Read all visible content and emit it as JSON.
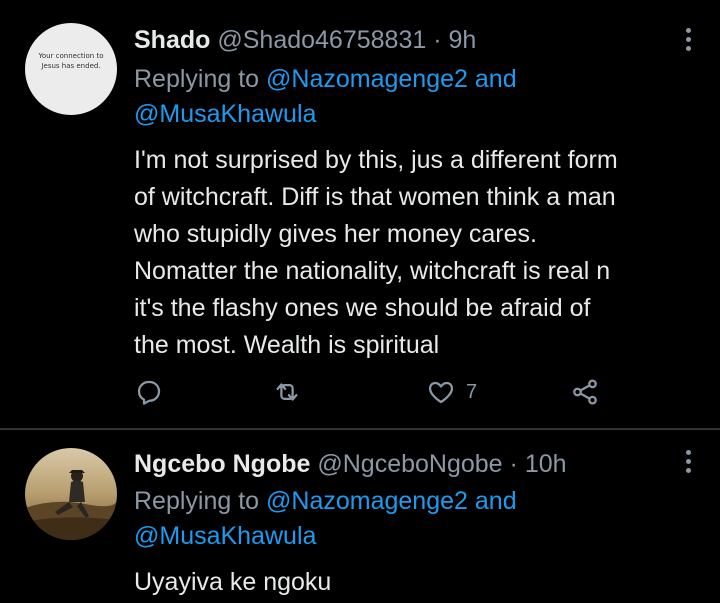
{
  "tweets": [
    {
      "avatar_text": "Your connection to Jesus has ended.",
      "display_name": "Shado",
      "handle": "@Shado46758831",
      "separator": "·",
      "time": "9h",
      "replying_prefix": "Replying to",
      "reply_user1": "@Nazomagenge2",
      "reply_and": "and",
      "reply_user2": "@MusaKhawula",
      "lines": [
        "I'm not surprised by this, jus a different form",
        "of witchcraft. Diff is that women think a man",
        "who stupidly gives her money cares.",
        "Nomatter the nationality,  witchcraft is real n",
        "it's the flashy ones we should be afraid of",
        "the most. Wealth is spiritual"
      ],
      "like_count": "7"
    },
    {
      "display_name": "Ngcebo Ngobe",
      "handle": "@NgceboNgobe",
      "separator": "·",
      "time": "10h",
      "replying_prefix": "Replying to",
      "reply_user1": "@Nazomagenge2",
      "reply_and": "and",
      "reply_user2": "@MusaKhawula",
      "lines": [
        "Uyayiva ke ngoku"
      ]
    }
  ],
  "icons": {
    "reply": "reply-icon",
    "retweet": "retweet-icon",
    "like": "heart-icon",
    "share": "share-icon",
    "more": "more-icon"
  },
  "colors": {
    "background": "#000000",
    "text": "#e7e9ea",
    "muted": "#8b98a5",
    "link": "#1d9bf0"
  }
}
